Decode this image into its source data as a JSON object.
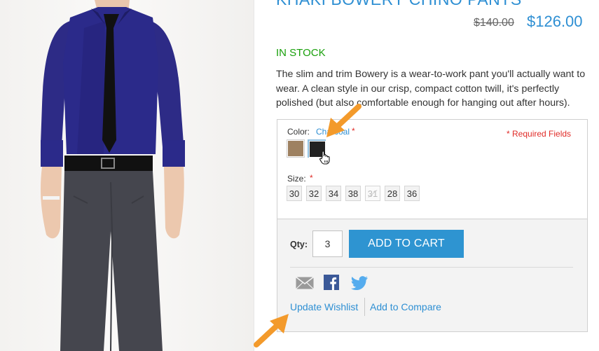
{
  "product": {
    "title": "KHAKI BOWERY CHINO PANTS",
    "old_price": "$140.00",
    "new_price": "$126.00",
    "stock_status": "IN STOCK",
    "description": "The slim and trim Bowery is a wear-to-work pant you'll actually want to wear. A clean style in our crisp, compact cotton twill, it's perfectly polished (but also comfortable enough for hanging out after hours)."
  },
  "options": {
    "color_label": "Color:",
    "color_value": "Charcoal",
    "required_star": "*",
    "required_fields": "* Required Fields",
    "swatches": [
      {
        "name": "khaki",
        "color": "#9e8161"
      },
      {
        "name": "charcoal",
        "color": "#222222",
        "selected": true
      }
    ],
    "size_label": "Size:",
    "sizes": [
      "30",
      "32",
      "34",
      "38",
      "31",
      "28",
      "36"
    ],
    "disabled_size": "31"
  },
  "cart": {
    "qty_label": "Qty:",
    "qty_value": "3",
    "add_to_cart_label": "ADD TO CART"
  },
  "links": {
    "update_wishlist": "Update Wishlist",
    "add_to_compare": "Add to Compare"
  },
  "icons": {
    "email": "email-icon",
    "facebook": "facebook-icon",
    "twitter": "twitter-icon"
  },
  "colors": {
    "accent": "#2e8fd3",
    "button": "#2e94d1",
    "stock": "#19a00b",
    "required": "#e02b27",
    "annotation_arrow": "#f39a2b"
  }
}
